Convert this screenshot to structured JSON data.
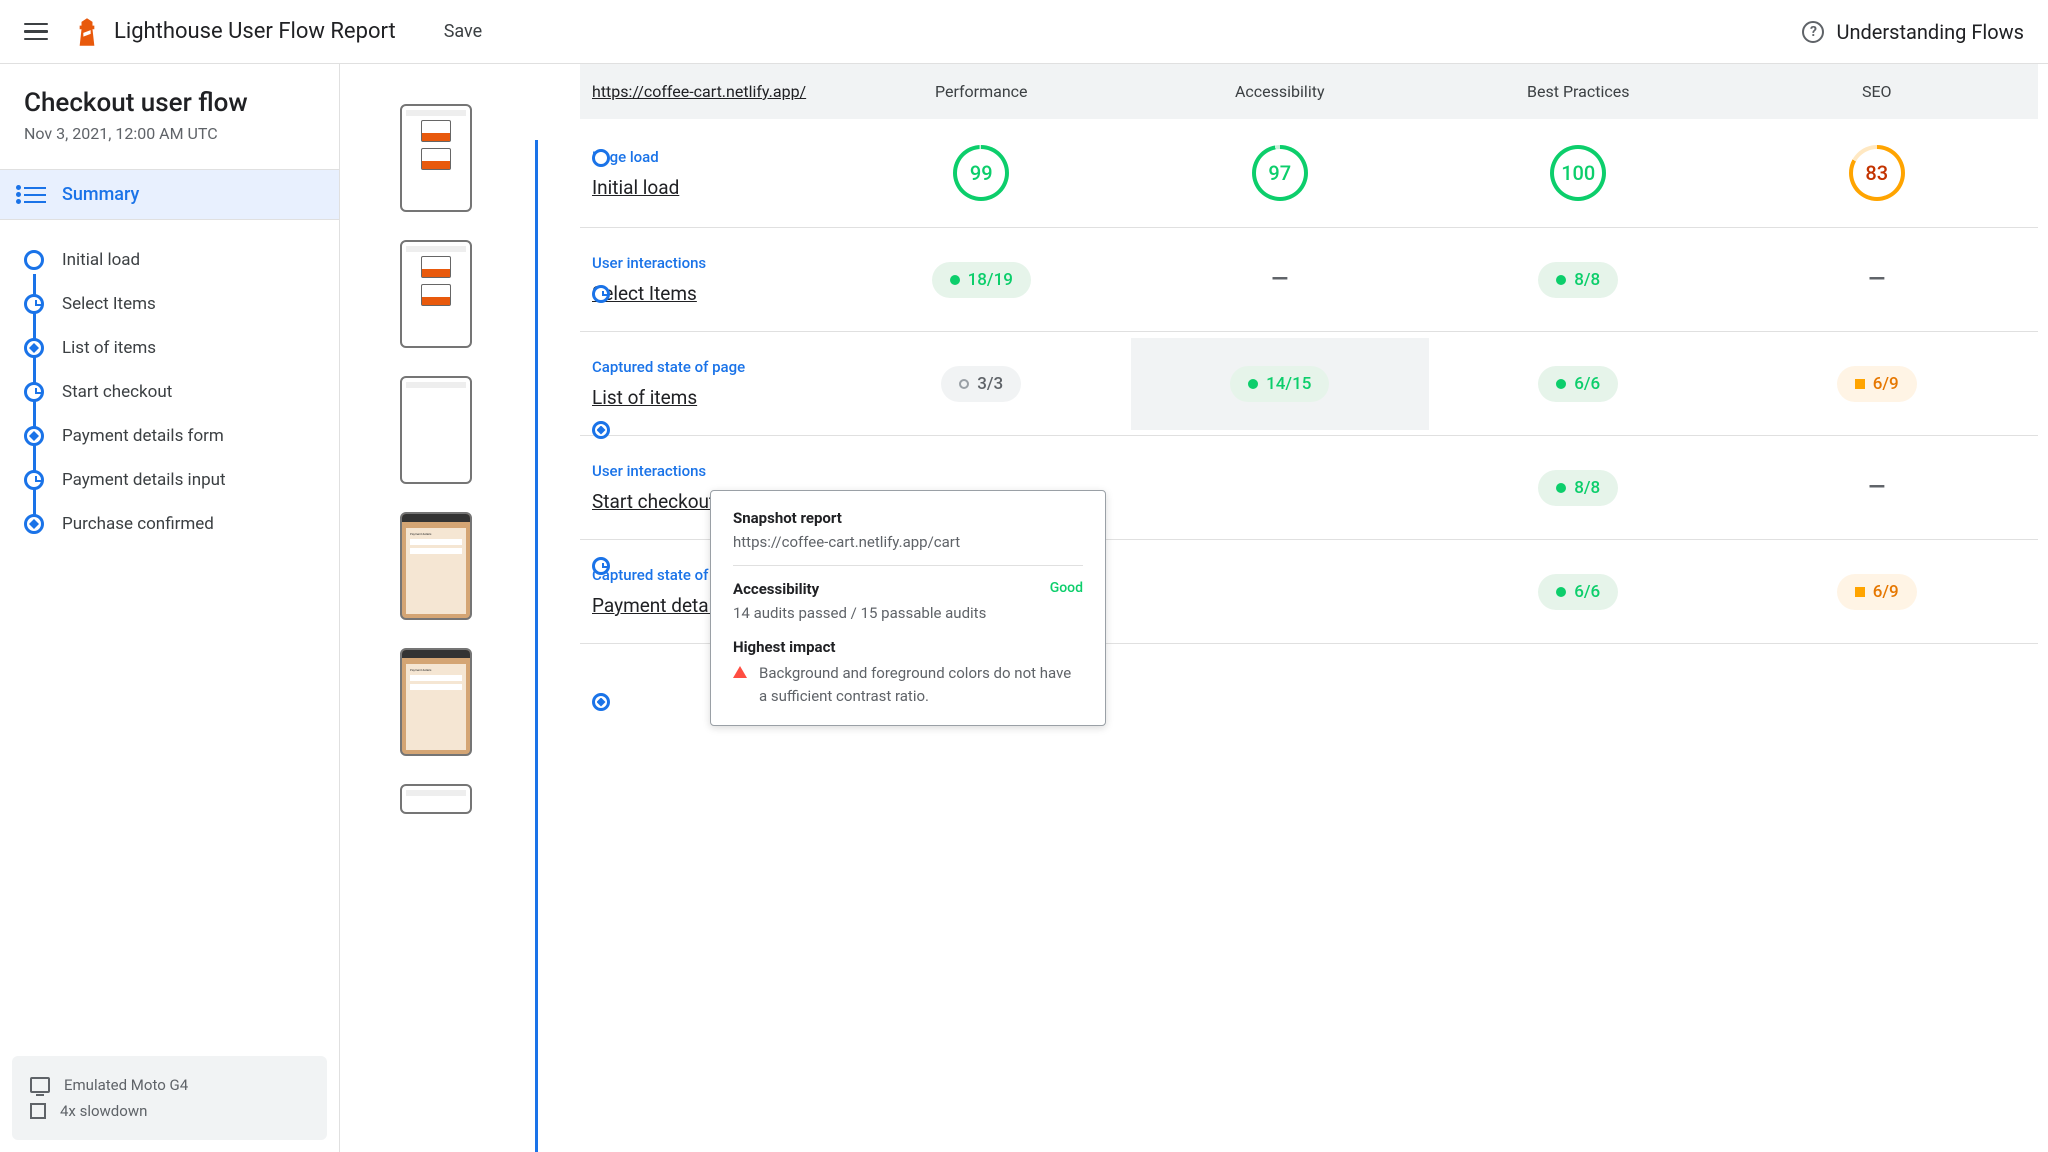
{
  "header": {
    "title": "Lighthouse User Flow Report",
    "save": "Save",
    "understanding": "Understanding Flows"
  },
  "sidebar": {
    "flow_title": "Checkout user flow",
    "flow_date": "Nov 3, 2021, 12:00 AM UTC",
    "summary_label": "Summary",
    "steps": [
      {
        "label": "Initial load",
        "marker": "circle"
      },
      {
        "label": "Select Items",
        "marker": "clock"
      },
      {
        "label": "List of items",
        "marker": "aperture"
      },
      {
        "label": "Start checkout",
        "marker": "clock"
      },
      {
        "label": "Payment details form",
        "marker": "aperture"
      },
      {
        "label": "Payment details input",
        "marker": "clock"
      },
      {
        "label": "Purchase confirmed",
        "marker": "aperture"
      }
    ],
    "device": "Emulated Moto G4",
    "throttle": "4x slowdown"
  },
  "table": {
    "url": "https://coffee-cart.netlify.app/",
    "cols": [
      "Performance",
      "Accessibility",
      "Best Practices",
      "SEO"
    ],
    "rows": [
      {
        "type": "Page load",
        "name": "Initial load",
        "cells": [
          {
            "kind": "gauge",
            "value": "99",
            "color": "green",
            "pct": 99
          },
          {
            "kind": "gauge",
            "value": "97",
            "color": "green",
            "pct": 97
          },
          {
            "kind": "gauge",
            "value": "100",
            "color": "green",
            "pct": 100
          },
          {
            "kind": "gauge",
            "value": "83",
            "color": "orange",
            "pct": 83
          }
        ]
      },
      {
        "type": "User interactions",
        "name": "Select Items",
        "cells": [
          {
            "kind": "pill",
            "value": "18/19",
            "color": "green"
          },
          {
            "kind": "dash"
          },
          {
            "kind": "pill",
            "value": "8/8",
            "color": "green"
          },
          {
            "kind": "dash"
          }
        ]
      },
      {
        "type": "Captured state of page",
        "name": "List of items",
        "cells": [
          {
            "kind": "pill",
            "value": "3/3",
            "color": "gray"
          },
          {
            "kind": "pill",
            "value": "14/15",
            "color": "green",
            "hovered": true
          },
          {
            "kind": "pill",
            "value": "6/6",
            "color": "green"
          },
          {
            "kind": "pill",
            "value": "6/9",
            "color": "orange"
          }
        ]
      },
      {
        "type": "User interactions",
        "name": "Start checkout",
        "cells": [
          {
            "kind": "hidden"
          },
          {
            "kind": "hidden"
          },
          {
            "kind": "pill",
            "value": "8/8",
            "color": "green"
          },
          {
            "kind": "dash"
          }
        ]
      },
      {
        "type": "Captured state of page",
        "name": "Payment details form",
        "cells": [
          {
            "kind": "hidden"
          },
          {
            "kind": "hidden"
          },
          {
            "kind": "pill",
            "value": "6/6",
            "color": "green"
          },
          {
            "kind": "pill",
            "value": "6/9",
            "color": "orange"
          }
        ]
      }
    ]
  },
  "popup": {
    "title": "Snapshot report",
    "url": "https://coffee-cart.netlify.app/cart",
    "category": "Accessibility",
    "rating": "Good",
    "summary": "14 audits passed / 15 passable audits",
    "impact_title": "Highest impact",
    "impact_text": "Background and foreground colors do not have a sufficient contrast ratio."
  },
  "timeline_markers": [
    "circle",
    "clock",
    "aperture",
    "clock",
    "aperture"
  ]
}
